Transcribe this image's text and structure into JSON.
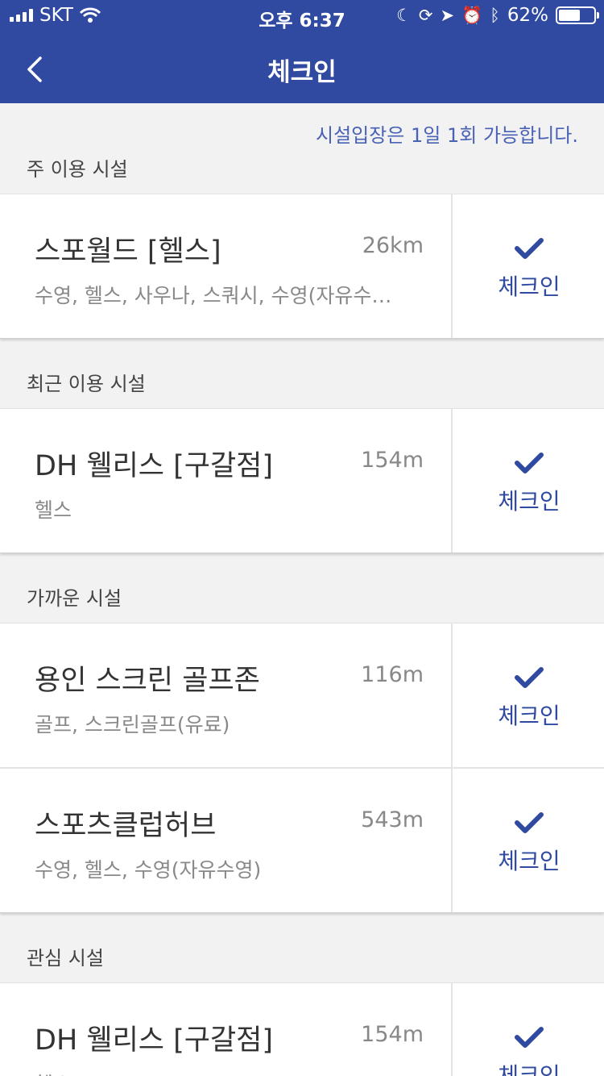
{
  "status_bar": {
    "carrier": "SKT",
    "time": "오후 6:37",
    "battery": "62%",
    "battery_level": 0.62
  },
  "nav": {
    "title": "체크인",
    "back_icon": "chevron-left-icon"
  },
  "notice": "시설입장은 1일 1회 가능합니다.",
  "sections": [
    {
      "label": "주 이용 시설",
      "items": [
        {
          "name": "스포월드 [헬스]",
          "distance": "26km",
          "tags": "수영, 헬스, 사우나, 스쿼시, 수영(자유수…",
          "checkin": "체크인"
        }
      ]
    },
    {
      "label": "최근 이용 시설",
      "items": [
        {
          "name": "DH 웰리스 [구갈점]",
          "distance": "154m",
          "tags": "헬스",
          "checkin": "체크인"
        }
      ]
    },
    {
      "label": "가까운 시설",
      "items": [
        {
          "name": "용인 스크린 골프존",
          "distance": "116m",
          "tags": "골프, 스크린골프(유료)",
          "checkin": "체크인"
        },
        {
          "name": "스포츠클럽허브",
          "distance": "543m",
          "tags": "수영, 헬스, 수영(자유수영)",
          "checkin": "체크인"
        }
      ]
    },
    {
      "label": "관심 시설",
      "items": [
        {
          "name": "DH 웰리스 [구갈점]",
          "distance": "154m",
          "tags": "헬스",
          "checkin": "체크인"
        }
      ]
    }
  ],
  "colors": {
    "header": "#2f4aa0",
    "accent": "#2f4aa0",
    "notice": "#4a62b5",
    "background": "#f2f2f2"
  }
}
